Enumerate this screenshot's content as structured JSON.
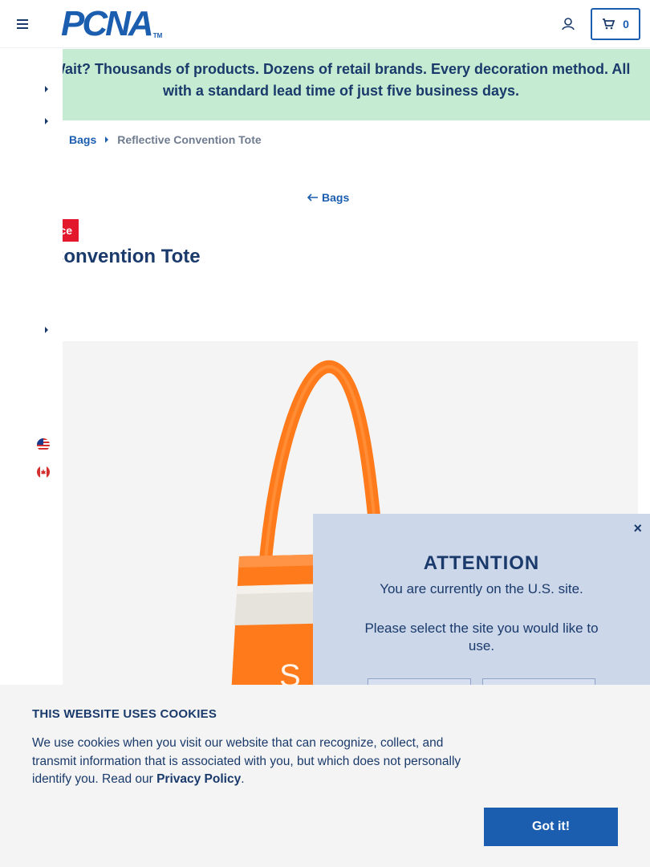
{
  "header": {
    "logo_text": "PCNA",
    "logo_tm": "TM",
    "cart_count": "0"
  },
  "banner": {
    "line1": "Wait? Thousands of products. Dozens of retail brands. Every decoration method. All",
    "line2": "with a standard lead time of just five business days."
  },
  "breadcrumb": {
    "parent": "Bags",
    "current": "Reflective Convention Tote"
  },
  "back_link": "Bags",
  "badge": "ce",
  "product": {
    "title": "Reflective Convention Tote",
    "color": "#ff7a1a"
  },
  "attention": {
    "title": "ATTENTION",
    "line1": "You are currently on the U.S. site.",
    "line2": "Please select the site you would like to use.",
    "close": "×"
  },
  "cookie": {
    "title": "THIS WEBSITE USES COOKIES",
    "text": "We use cookies when you visit our website that can recognize, collect, and transmit information that is associated with you, but which does not personally identify you. Read our ",
    "link": "Privacy Policy",
    "period": ".",
    "button": "Got it!"
  },
  "colors": {
    "brand_blue": "#1b5daf",
    "navy": "#1a3a6b",
    "banner_green": "#c5ecd2",
    "badge_red": "#e3182d",
    "modal_blue": "#ccd7ea"
  }
}
